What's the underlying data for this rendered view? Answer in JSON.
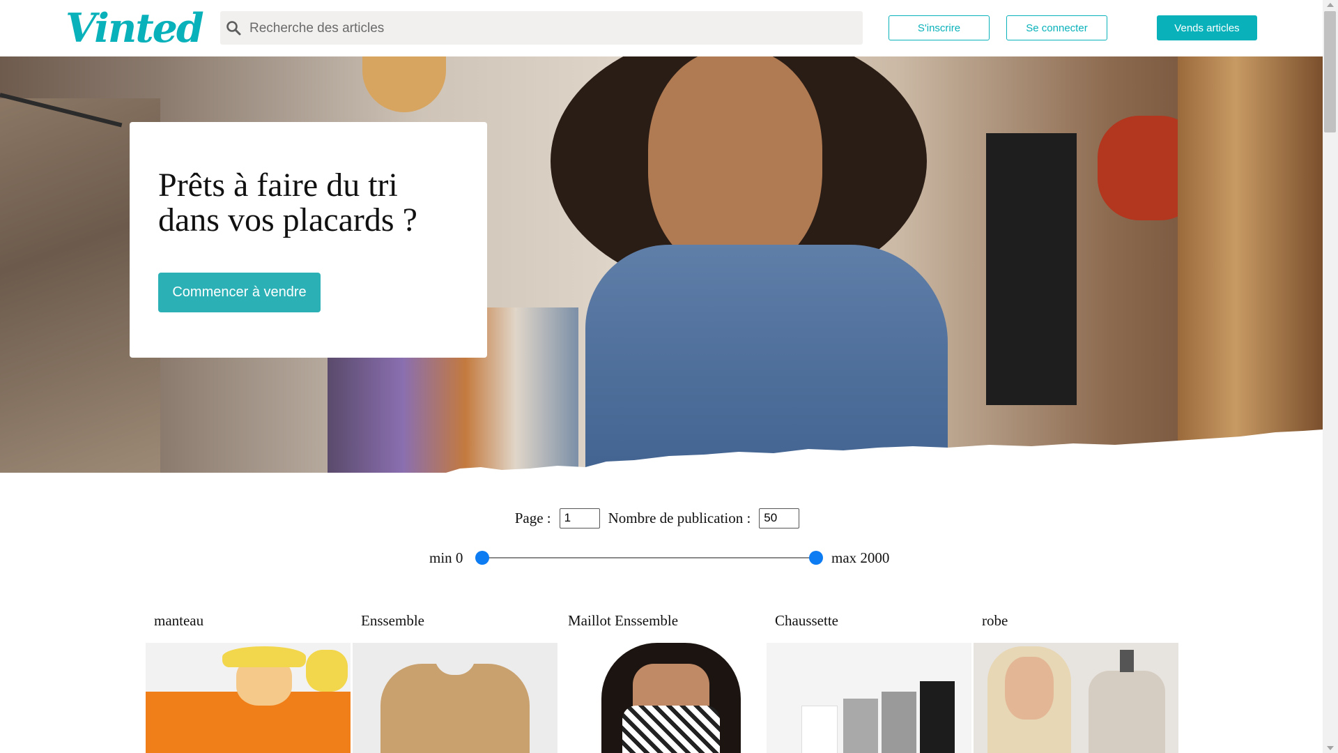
{
  "header": {
    "logo_text": "Vinted",
    "search_placeholder": "Recherche des articles",
    "signup_label": "S'inscrire",
    "login_label": "Se connecter",
    "sell_label": "Vends articles"
  },
  "hero": {
    "title": "Prêts à faire du tri dans vos placards ?",
    "cta_label": "Commencer à vendre"
  },
  "filters": {
    "page_label": "Page :",
    "page_value": "1",
    "count_label": "Nombre de publication :",
    "count_value": "50",
    "range_min_label": "min 0",
    "range_max_label": "max 2000"
  },
  "products": [
    {
      "title": "manteau"
    },
    {
      "title": "Enssemble"
    },
    {
      "title": "Maillot Enssemble"
    },
    {
      "title": "Chaussette"
    },
    {
      "title": "robe"
    }
  ],
  "colors": {
    "brand": "#09b1ba",
    "cta": "#2ab0b5",
    "slider_thumb": "#0d7cf2"
  }
}
